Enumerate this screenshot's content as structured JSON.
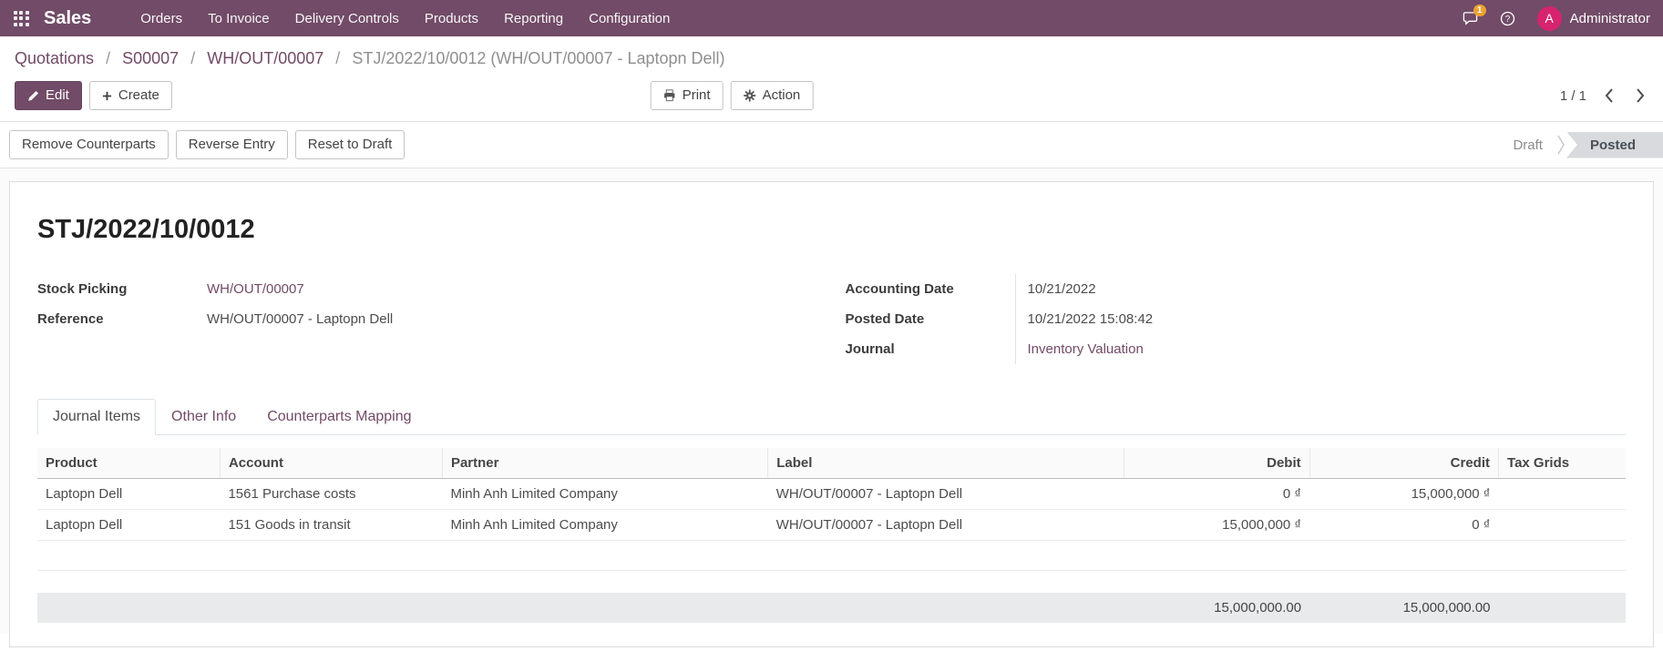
{
  "nav": {
    "app_name": "Sales",
    "items": [
      "Orders",
      "To Invoice",
      "Delivery Controls",
      "Products",
      "Reporting",
      "Configuration"
    ],
    "badge_count": "1",
    "avatar_initial": "A",
    "user_name": "Administrator"
  },
  "breadcrumb": {
    "links": [
      "Quotations",
      "S00007",
      "WH/OUT/00007"
    ],
    "current": "STJ/2022/10/0012 (WH/OUT/00007 - Laptopn Dell)",
    "separator": "/"
  },
  "control_panel": {
    "edit_label": "Edit",
    "create_label": "Create",
    "print_label": "Print",
    "action_label": "Action",
    "pager": "1 / 1"
  },
  "toolbar": {
    "buttons": [
      "Remove Counterparts",
      "Reverse Entry",
      "Reset to Draft"
    ],
    "statusbar": [
      {
        "label": "Draft",
        "active": false
      },
      {
        "label": "Posted",
        "active": true
      }
    ]
  },
  "form": {
    "title": "STJ/2022/10/0012",
    "left_fields": [
      {
        "label": "Stock Picking",
        "value": "WH/OUT/00007",
        "link": true
      },
      {
        "label": "Reference",
        "value": "WH/OUT/00007 - Laptopn Dell",
        "link": false
      }
    ],
    "right_fields": [
      {
        "label": "Accounting Date",
        "value": "10/21/2022",
        "link": false
      },
      {
        "label": "Posted Date",
        "value": "10/21/2022 15:08:42",
        "link": false
      },
      {
        "label": "Journal",
        "value": "Inventory Valuation",
        "link": true
      }
    ],
    "tabs": [
      {
        "label": "Journal Items",
        "active": true
      },
      {
        "label": "Other Info",
        "active": false
      },
      {
        "label": "Counterparts Mapping",
        "active": false
      }
    ]
  },
  "table": {
    "columns": [
      "Product",
      "Account",
      "Partner",
      "Label",
      "Debit",
      "Credit",
      "Tax Grids"
    ],
    "rows": [
      {
        "product": "Laptopn Dell",
        "account": "1561 Purchase costs",
        "partner": "Minh Anh Limited Company",
        "label": "WH/OUT/00007 - Laptopn Dell",
        "debit": "0 ₫",
        "credit": "15,000,000 ₫",
        "tax_grids": ""
      },
      {
        "product": "Laptopn Dell",
        "account": "151 Goods in transit",
        "partner": "Minh Anh Limited Company",
        "label": "WH/OUT/00007 - Laptopn Dell",
        "debit": "15,000,000 ₫",
        "credit": "0 ₫",
        "tax_grids": ""
      }
    ],
    "totals": {
      "debit": "15,000,000.00",
      "credit": "15,000,000.00"
    }
  },
  "colors": {
    "navbar": "#714B67",
    "primary_button": "#714B67",
    "link": "#714B67",
    "avatar_bg": "#d6246e",
    "badge_bg": "#eda12f",
    "status_active_bg": "#d8dadd",
    "totals_row_bg": "#e9eaec"
  }
}
